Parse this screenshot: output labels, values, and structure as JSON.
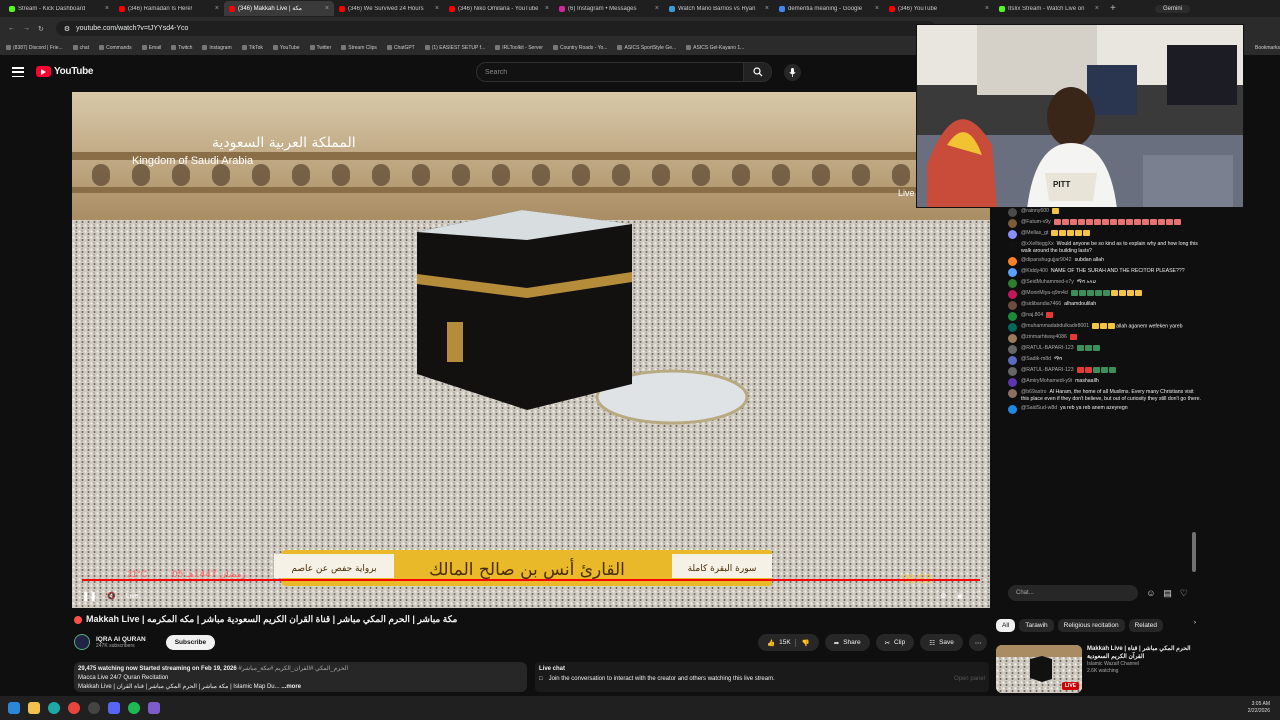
{
  "browser": {
    "tabs": [
      {
        "title": "Stream - Kick Dashboard",
        "color": "#53fc18",
        "active": false
      },
      {
        "title": "(346) Ramadan Is Here!",
        "color": "#ff0000",
        "active": false
      },
      {
        "title": "(346) Makkah Live | مكة",
        "color": "#ff0000",
        "active": true
      },
      {
        "title": "(346) We Survived 24 Hours",
        "color": "#ff0000",
        "active": false
      },
      {
        "title": "(346) Niko Omilana - YouTube",
        "color": "#ff0000",
        "active": false
      },
      {
        "title": "(6) Instagram • Messages",
        "color": "#d6249f",
        "active": false
      },
      {
        "title": "Watch Mario Barrios vs Ryan",
        "color": "#3a9bd9",
        "active": false
      },
      {
        "title": "dementia meaning - Google",
        "color": "#4285f4",
        "active": false
      },
      {
        "title": "(346) YouTube",
        "color": "#ff0000",
        "active": false
      },
      {
        "title": "ItsIix Stream - Watch Live on",
        "color": "#53fc18",
        "active": false
      }
    ],
    "new_tab": "+",
    "gemini_label": "Gemini",
    "url": "youtube.com/watch?v=tJYYsd4-Yco",
    "bookmarks": [
      "(8387) Discord | Frie...",
      "chat",
      "Commands",
      "Email",
      "Twitch",
      "Instagram",
      "TikTok",
      "YouTube",
      "Twitter",
      "Stream Clips",
      "ChatGPT",
      "(1) EASIEST SETUP f...",
      "IRLToolkit - Server",
      "Country Roads - Yo...",
      "ASICS SportStyle Ge...",
      "ASICS Gel-Kayano 1..."
    ],
    "bookmarks_more": "Bookmarks"
  },
  "youtube": {
    "logo_text": "YouTube",
    "search_placeholder": "Search"
  },
  "video": {
    "overlay_arabic_top": "المملكة العربية السعودية",
    "overlay_english_top": "Kingdom of Saudi Arabia",
    "overlay_live": "Live",
    "banner_reader": "القارئ أنس بن صالح المالك",
    "banner_left": "برواية حفص عن عاصم",
    "banner_right": "سورة البقرة كاملة",
    "temp": "21°C",
    "date_hijri": "05 رمضان 1447هـ",
    "clock": "06:53",
    "live_label": "Live"
  },
  "chat": {
    "messages": [
      {
        "user": "@rainny600",
        "text": "",
        "emoji": [
          "#f5c542"
        ],
        "color": "#4a4a4a"
      },
      {
        "user": "@Fatum-v9y",
        "text": "",
        "emoji": [
          "#e57373",
          "#e57373",
          "#e57373",
          "#e57373",
          "#e57373",
          "#e57373",
          "#e57373",
          "#e57373",
          "#e57373",
          "#e57373",
          "#e57373",
          "#e57373",
          "#e57373",
          "#e57373",
          "#e57373",
          "#e57373"
        ],
        "color": "#7a5c3b"
      },
      {
        "user": "@Mellas_gt",
        "text": "",
        "emoji": [
          "#f5c542",
          "#f5c542",
          "#f5c542",
          "#f5c542",
          "#f5c542"
        ],
        "color": "#8a8fff"
      },
      {
        "user": "@xXellteggXx",
        "text": "Would anyone be so kind as to explain why and how long this walk around the building lasts?",
        "emoji": [],
        "color": "#111111"
      },
      {
        "user": "@dipanshugujjar9042",
        "text": "subdan allah",
        "emoji": [],
        "color": "#ff7f27"
      },
      {
        "user": "@Kiddy400",
        "text": "NAME OF THE SURAH AND THE RECITOR PLEASE???",
        "emoji": [],
        "color": "#5aa0ff"
      },
      {
        "user": "@SeidMuhammed-v7y",
        "text": "ማሻ አላህ",
        "emoji": [],
        "color": "#2e7d32"
      },
      {
        "user": "@MonirMiya-q9m4d",
        "text": "",
        "emoji": [
          "#3a8f5a",
          "#3a8f5a",
          "#3a8f5a",
          "#3a8f5a",
          "#3a8f5a",
          "#f5c542",
          "#f5c542",
          "#f5c542",
          "#f5c542"
        ],
        "color": "#c2185b"
      },
      {
        "user": "@sidibandia7466",
        "text": "alhamdoulilah",
        "emoji": [],
        "color": "#6d4c41"
      },
      {
        "user": "@naj.804",
        "text": "",
        "emoji": [
          "#e53935"
        ],
        "color": "#1b8a3a"
      },
      {
        "user": "@muhammadabdulkadir8001",
        "text": "allah aganem wefeken yareb",
        "emoji": [
          "#f5c542",
          "#f5c542",
          "#f5c542"
        ],
        "color": "#00695c"
      },
      {
        "user": "@zinmarhtway4086",
        "text": "",
        "emoji": [
          "#e53935"
        ],
        "color": "#9c7b5a"
      },
      {
        "user": "@RATUL-BAPARI-123",
        "text": "",
        "emoji": [
          "#3a8f5a",
          "#3a8f5a",
          "#3a8f5a"
        ],
        "color": "#666666"
      },
      {
        "user": "@Sadik-m8d",
        "text": "ማሻ",
        "emoji": [],
        "color": "#5c6bc0"
      },
      {
        "user": "@RATUL-BAPARI-123",
        "text": "",
        "emoji": [
          "#e53935",
          "#e53935",
          "#3a8f5a",
          "#3a8f5a",
          "#3a8f5a"
        ],
        "color": "#666666"
      },
      {
        "user": "@AmiryMohamedi-y9i",
        "text": "mashaallh",
        "emoji": [],
        "color": "#5e35b1"
      },
      {
        "user": "@b69astro",
        "text": "Al Haram, the home of all Muslims. Every many Christians visit this place even if they don't believe, but out of curiosity they still don't go there.",
        "emoji": [],
        "color": "#8d6e63"
      },
      {
        "user": "@SaidSud-w8d",
        "text": "ya reb ya reb anem azeyregn",
        "emoji": [],
        "color": "#1e88e5"
      }
    ],
    "input_placeholder": "Chat..."
  },
  "info": {
    "title": "Makkah Live | مكة مباشر | الحرم المكي مباشر | قناة القران الكريم السعودية مباشر | مكه المكرمه",
    "channel": "IQRA AI QURAN",
    "subscribers": "247K subscribers",
    "subscribe_label": "Subscribe",
    "likes": "15K",
    "share_label": "Share",
    "clip_label": "Clip",
    "save_label": "Save",
    "views": "29,475 watching now",
    "started": "Started streaming on Feb 19, 2026",
    "desc_tags": "#الحرم_المكي #القران_الكريم #مكة_مباشر",
    "desc_line1": "Macca Live 24/7 Quran Recitation",
    "desc_line2": "Makkah Live | مكة مباشر | الحرم المكي مباشر | قناة القران | Islamic Map Du...",
    "more_label": "...more",
    "live_chat_label": "Live chat",
    "live_chat_text": "Join the conversation to interact with the creator and others watching this live stream.",
    "open_panel": "Open panel"
  },
  "related": {
    "chips": [
      "All",
      "Tarawih",
      "Religious recitation",
      "Related"
    ],
    "item_title": "Makkah Live | الحرم المكي مباشر | قناة القرآن الكريم السعودية",
    "item_channel": "Islamic Wazaif Channel",
    "item_views": "2.6K watching",
    "live_badge": "LIVE"
  },
  "taskbar": {
    "time": "3:05 AM",
    "date": "2/22/2026"
  }
}
